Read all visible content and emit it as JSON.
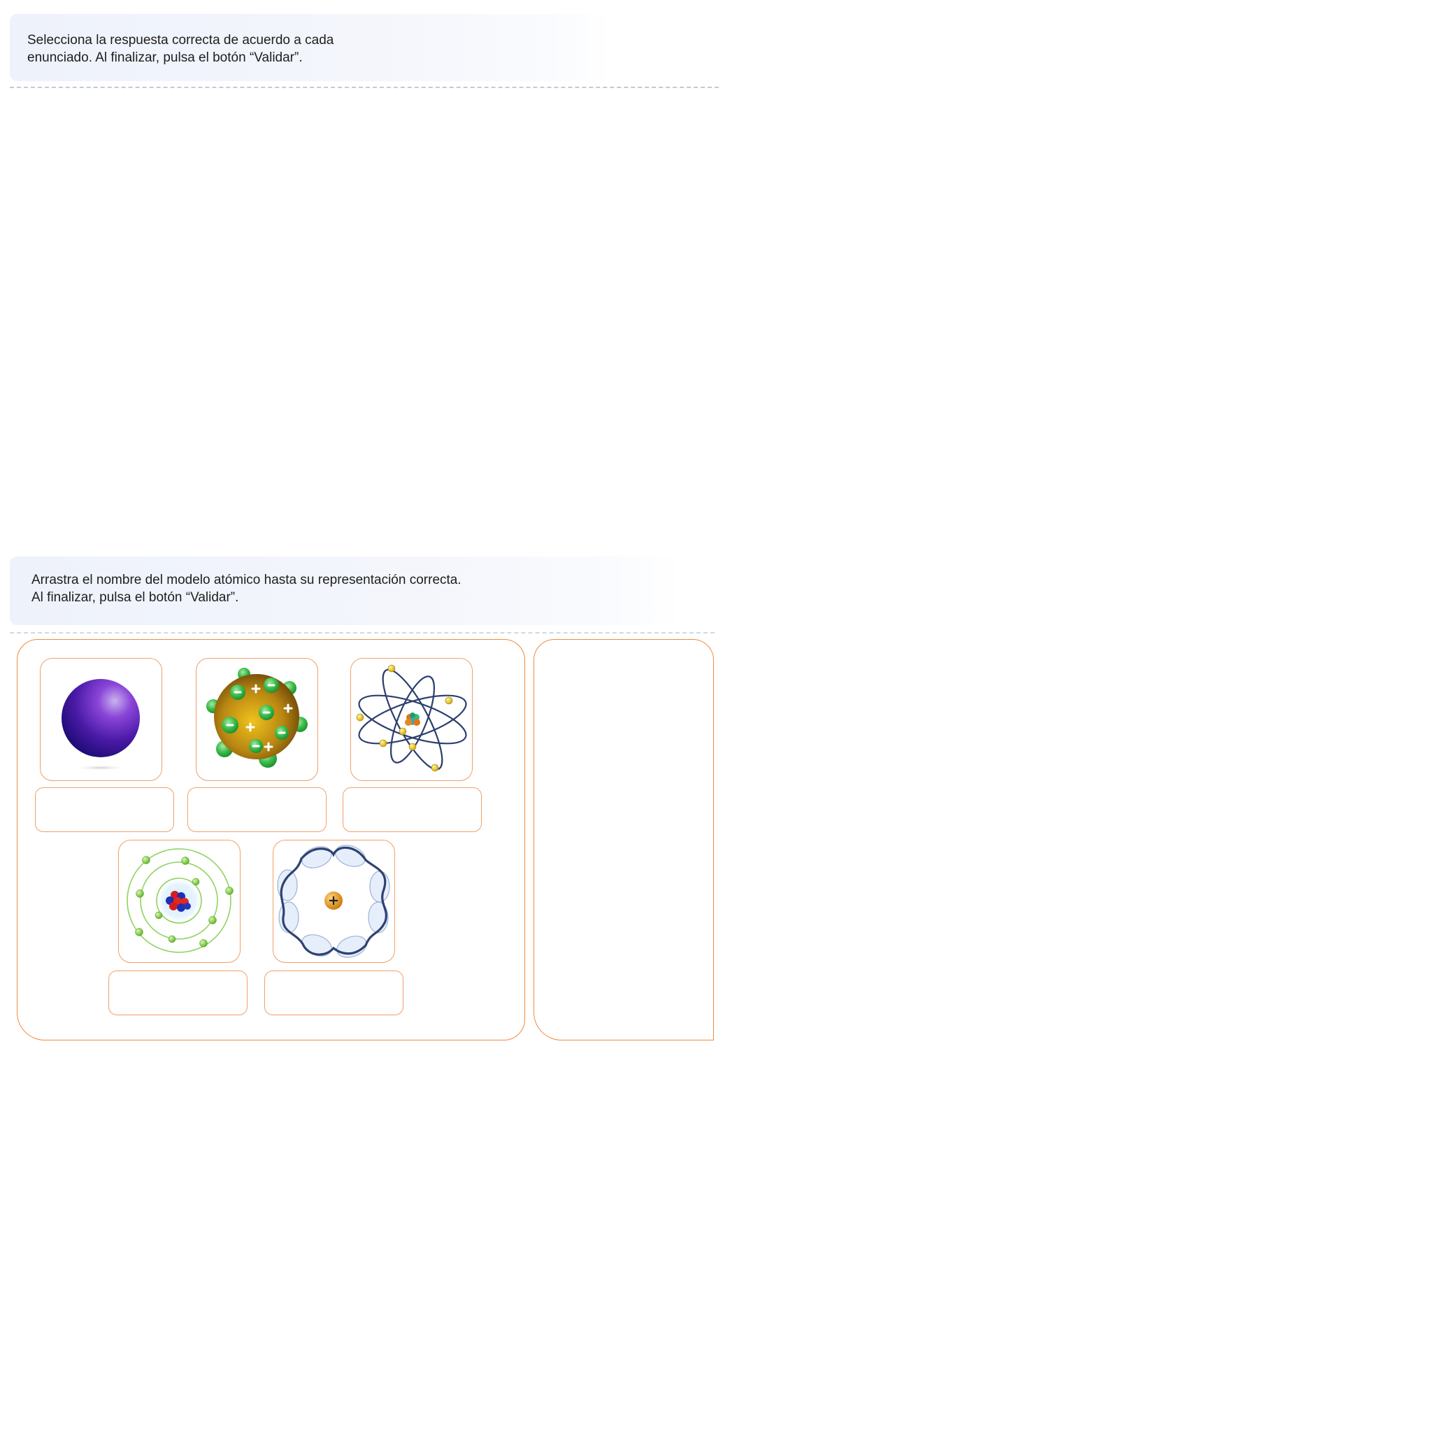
{
  "activity1": {
    "instruction": "Selecciona la respuesta correcta de acuerdo a cada\nenunciado. Al finalizar, pulsa el botón “Validar”."
  },
  "activity2": {
    "instruction": "Arrastra el nombre del modelo atómico hasta su representación correcta.\nAl finalizar, pulsa el botón “Validar”.",
    "images": [
      {
        "icon": "dalton-sphere-model-icon"
      },
      {
        "icon": "thomson-plum-pudding-model-icon"
      },
      {
        "icon": "rutherford-orbital-model-icon"
      },
      {
        "icon": "bohr-shell-model-icon"
      },
      {
        "icon": "quantum-wave-model-icon"
      }
    ],
    "drop_slots": [
      "",
      "",
      "",
      "",
      ""
    ],
    "word_bank": []
  },
  "colors": {
    "accent_border": "#f08a3e",
    "instruction_bg": "#eef2fb",
    "divider": "#c3c9d6"
  }
}
